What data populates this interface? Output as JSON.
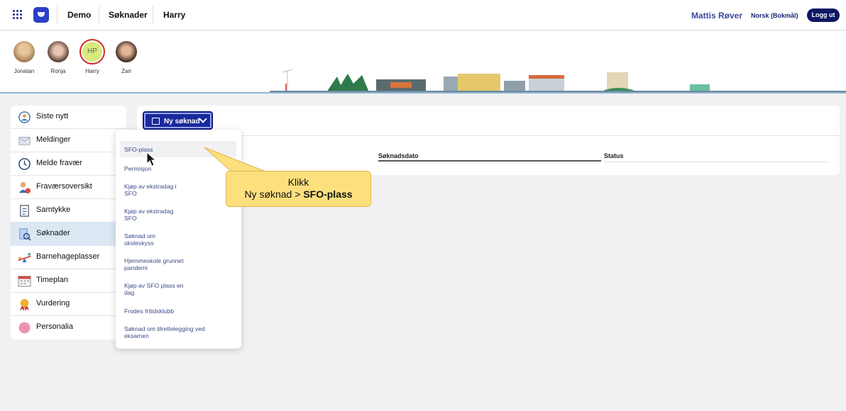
{
  "topbar": {
    "nav": [
      "Demo",
      "Søknader",
      "Harry"
    ],
    "user_name": "Mattis Røver",
    "language": "Norsk (Bokmål)",
    "logout_label": "Logg ut"
  },
  "children": [
    {
      "name": "Jonatan"
    },
    {
      "name": "Ronja"
    },
    {
      "name": "Harry",
      "initials": "HP"
    },
    {
      "name": "Zari"
    }
  ],
  "sidebar": {
    "items": [
      {
        "label": "Siste nytt",
        "icon": "news-icon"
      },
      {
        "label": "Meldinger",
        "icon": "envelope-icon"
      },
      {
        "label": "Melde fravær",
        "icon": "clock-icon"
      },
      {
        "label": "Fraværsoversikt",
        "icon": "absence-person-icon"
      },
      {
        "label": "Samtykke",
        "icon": "checklist-icon"
      },
      {
        "label": "Søknader",
        "icon": "application-search-icon",
        "active": true
      },
      {
        "label": "Barnehageplasser",
        "icon": "seesaw-icon"
      },
      {
        "label": "Timeplan",
        "icon": "calendar-icon"
      },
      {
        "label": "Vurdering",
        "icon": "medal-icon"
      },
      {
        "label": "Personalia",
        "icon": "fingerprint-icon"
      }
    ]
  },
  "main": {
    "new_button_label": "Ny søknad",
    "columns": [
      "Søknadsdato",
      "Status"
    ]
  },
  "dropdown": {
    "items": [
      "SFO-plass",
      "Permisjon",
      "Kjøp av ekstradag i\nSFO",
      "Kjøp av ekstradag\nSFO",
      "Søknad om\nskoleskyss",
      "Hjemmeskole grunnet\npandemi",
      "Kjøp av SFO plass en\ndag",
      "Frodes fritidsklubb",
      "Søknad om tilrettelegging ved\neksamen"
    ]
  },
  "callout": {
    "line1": "Klikk",
    "line2_prefix": "Ny søknad > ",
    "line2_bold": "SFO-plass"
  },
  "colors": {
    "accent": "#1a2a9c",
    "brand_dark": "#0d1766",
    "callout": "#fde07e",
    "active_item": "#dbe8f4"
  }
}
